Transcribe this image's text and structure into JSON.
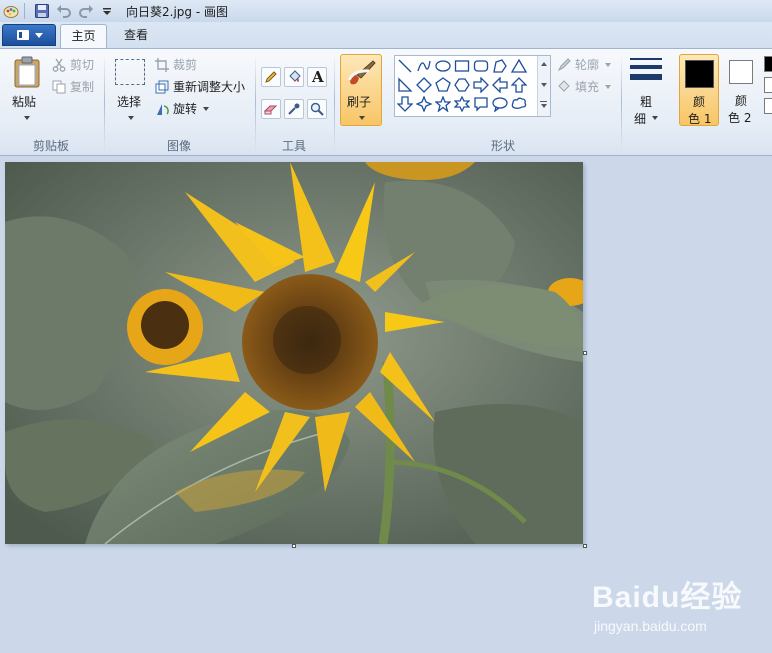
{
  "window": {
    "title": "向日葵2.jpg - 画图"
  },
  "tabs": {
    "home": "主页",
    "view": "查看"
  },
  "clipboard": {
    "paste": "粘贴",
    "cut": "剪切",
    "copy": "复制",
    "group": "剪贴板"
  },
  "image": {
    "select": "选择",
    "crop": "裁剪",
    "resize": "重新调整大小",
    "rotate": "旋转",
    "group": "图像"
  },
  "tools": {
    "group": "工具",
    "text_glyph": "A"
  },
  "brushes": {
    "label": "刷子"
  },
  "shapes": {
    "outline": "轮廓",
    "fill": "填充",
    "group": "形状"
  },
  "size": {
    "label_line1": "粗",
    "label_line2": "细"
  },
  "colors": {
    "color1_line1": "颜",
    "color1_line2": "色 1",
    "color2_line1": "颜",
    "color2_line2": "色 2",
    "color1_value": "#000000",
    "color2_value": "#ffffff",
    "accent": "#f8c566"
  },
  "watermark": {
    "brand": "Baidu经验",
    "url": "jingyan.baidu.com"
  }
}
